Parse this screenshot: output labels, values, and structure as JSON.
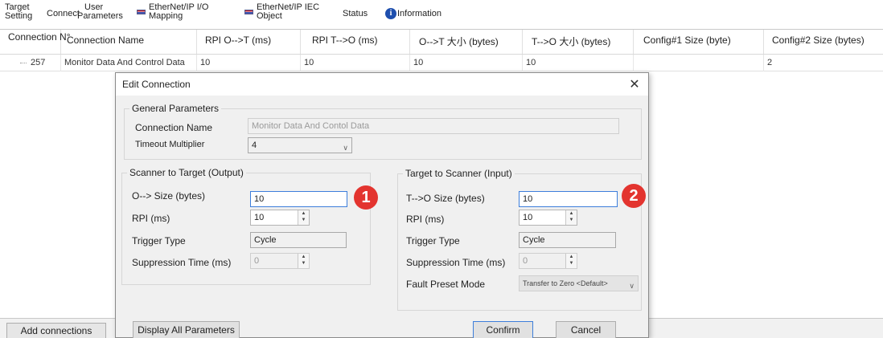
{
  "tabs": {
    "target_setting": [
      "Target",
      "Setting"
    ],
    "connect": "Connect",
    "user_parameters": [
      "User",
      "Parameters"
    ],
    "io_mapping": [
      "EtherNet/IP I/O",
      "Mapping"
    ],
    "iec_object": [
      "EtherNet/IP IEC",
      "Object"
    ],
    "status": "Status",
    "information": "Information"
  },
  "grid": {
    "columns": [
      "Connection N°",
      "Connection Name",
      "RPI O-->T (ms)",
      "RPI T-->O (ms)",
      "O-->T 大小 (bytes)",
      "T-->O 大小 (bytes)",
      "Config#1 Size (byte)",
      "Config#2 Size (bytes)"
    ],
    "rows": [
      {
        "connection_no": "257",
        "name": "Monitor Data And Control Data",
        "rpi_ot": "10",
        "rpi_to": "10",
        "size_ot": "10",
        "size_to": "10",
        "config1": "",
        "config2": "2"
      }
    ]
  },
  "add_connections": "Add connections",
  "dialog": {
    "title": "Edit Connection",
    "close": "✕",
    "general": {
      "legend": "General Parameters",
      "connection_name_label": "Connection Name",
      "connection_name_value": "Monitor Data And Contol Data",
      "timeout_label": "Timeout Multiplier",
      "timeout_value": "4"
    },
    "output": {
      "legend": "Scanner to Target (Output)",
      "size_label": "O--> Size (bytes)",
      "size_value": "10",
      "rpi_label": "RPI (ms)",
      "rpi_value": "10",
      "trigger_label": "Trigger Type",
      "trigger_value": "Cycle",
      "suppression_label": "Suppression Time (ms)",
      "suppression_value": "0"
    },
    "input": {
      "legend": "Target to Scanner (Input)",
      "size_label": "T-->O Size (bytes)",
      "size_value": "10",
      "rpi_label": "RPI (ms)",
      "rpi_value": "10",
      "trigger_label": "Trigger Type",
      "trigger_value": "Cycle",
      "suppression_label": "Suppression Time (ms)",
      "suppression_value": "0",
      "fault_label": "Fault Preset Mode",
      "fault_value": "Transfer to Zero <Default>"
    },
    "badges": [
      "1",
      "2"
    ],
    "display_all": "Display All Parameters >>",
    "confirm": "Confirm",
    "cancel": "Cancel"
  },
  "colors": {
    "badge": "#e3342f",
    "focus_border": "#3d7edb",
    "info_icon": "#1e4fae"
  }
}
